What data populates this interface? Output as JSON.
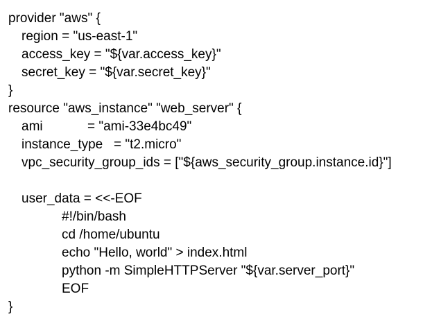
{
  "code_lines": [
    "provider \"aws\" {",
    "region = \"us-east-1\"",
    "access_key = \"${var.access_key}\"",
    "secret_key = \"${var.secret_key}\"",
    "}",
    "resource \"aws_instance\" \"web_server\" {",
    "ami",
    "= \"ami-33e4bc49\"",
    "instance_type",
    "= \"t2.micro\"",
    "vpc_security_group_ids = [\"${aws_security_group.instance.id}\"]",
    "user_data = <<-EOF",
    "#!/bin/bash",
    "cd /home/ubuntu",
    "echo \"Hello, world\" > index.html",
    "python -m SimpleHTTPServer \"${var.server_port}\"",
    "EOF",
    "}"
  ]
}
